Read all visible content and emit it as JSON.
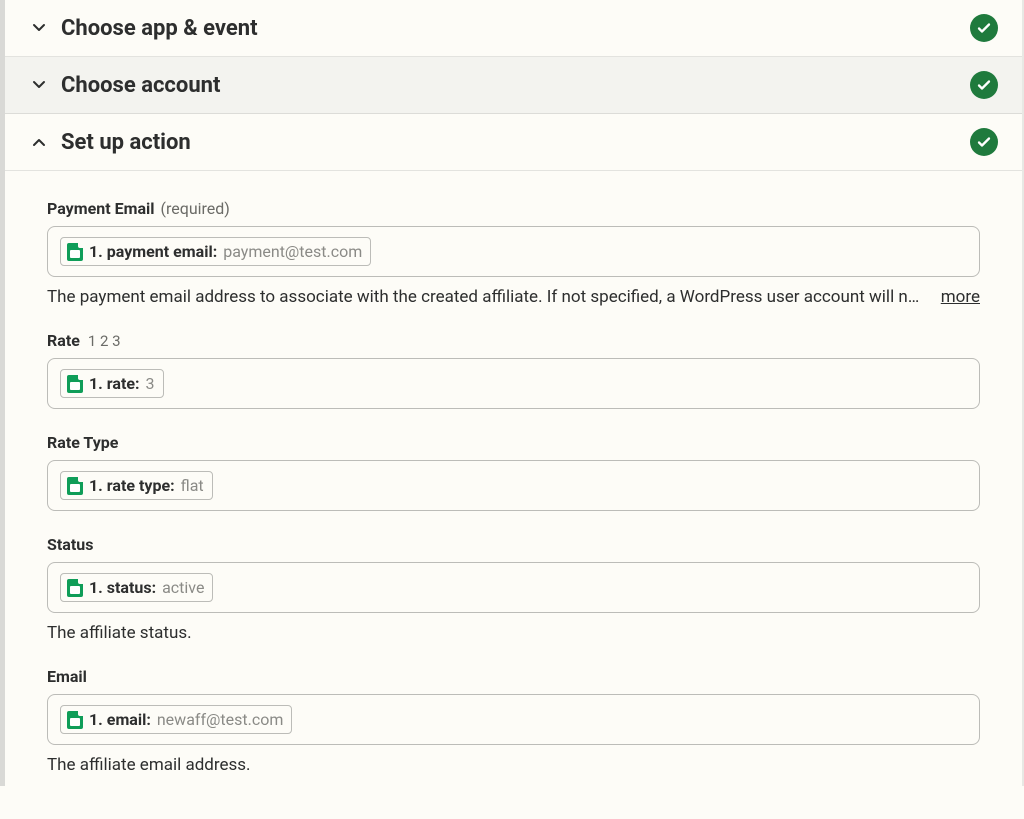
{
  "sections": {
    "choose_app": {
      "title": "Choose app & event",
      "completed": true,
      "expanded": false
    },
    "choose_account": {
      "title": "Choose account",
      "completed": true,
      "expanded": false
    },
    "set_up_action": {
      "title": "Set up action",
      "completed": true,
      "expanded": true
    }
  },
  "fields": {
    "payment_email": {
      "label": "Payment Email",
      "required_text": "(required)",
      "pill_label": "1. payment email:",
      "pill_value": "payment@test.com",
      "help": "The payment email address to associate with the created affiliate. If not specified, a WordPress user account will not ...",
      "more": "more"
    },
    "rate": {
      "label": "Rate",
      "hint": "1 2 3",
      "pill_label": "1. rate:",
      "pill_value": "3"
    },
    "rate_type": {
      "label": "Rate Type",
      "pill_label": "1. rate type:",
      "pill_value": "flat"
    },
    "status": {
      "label": "Status",
      "pill_label": "1. status:",
      "pill_value": "active",
      "help": "The affiliate status."
    },
    "email": {
      "label": "Email",
      "pill_label": "1. email:",
      "pill_value": "newaff@test.com",
      "help": "The affiliate email address."
    }
  }
}
